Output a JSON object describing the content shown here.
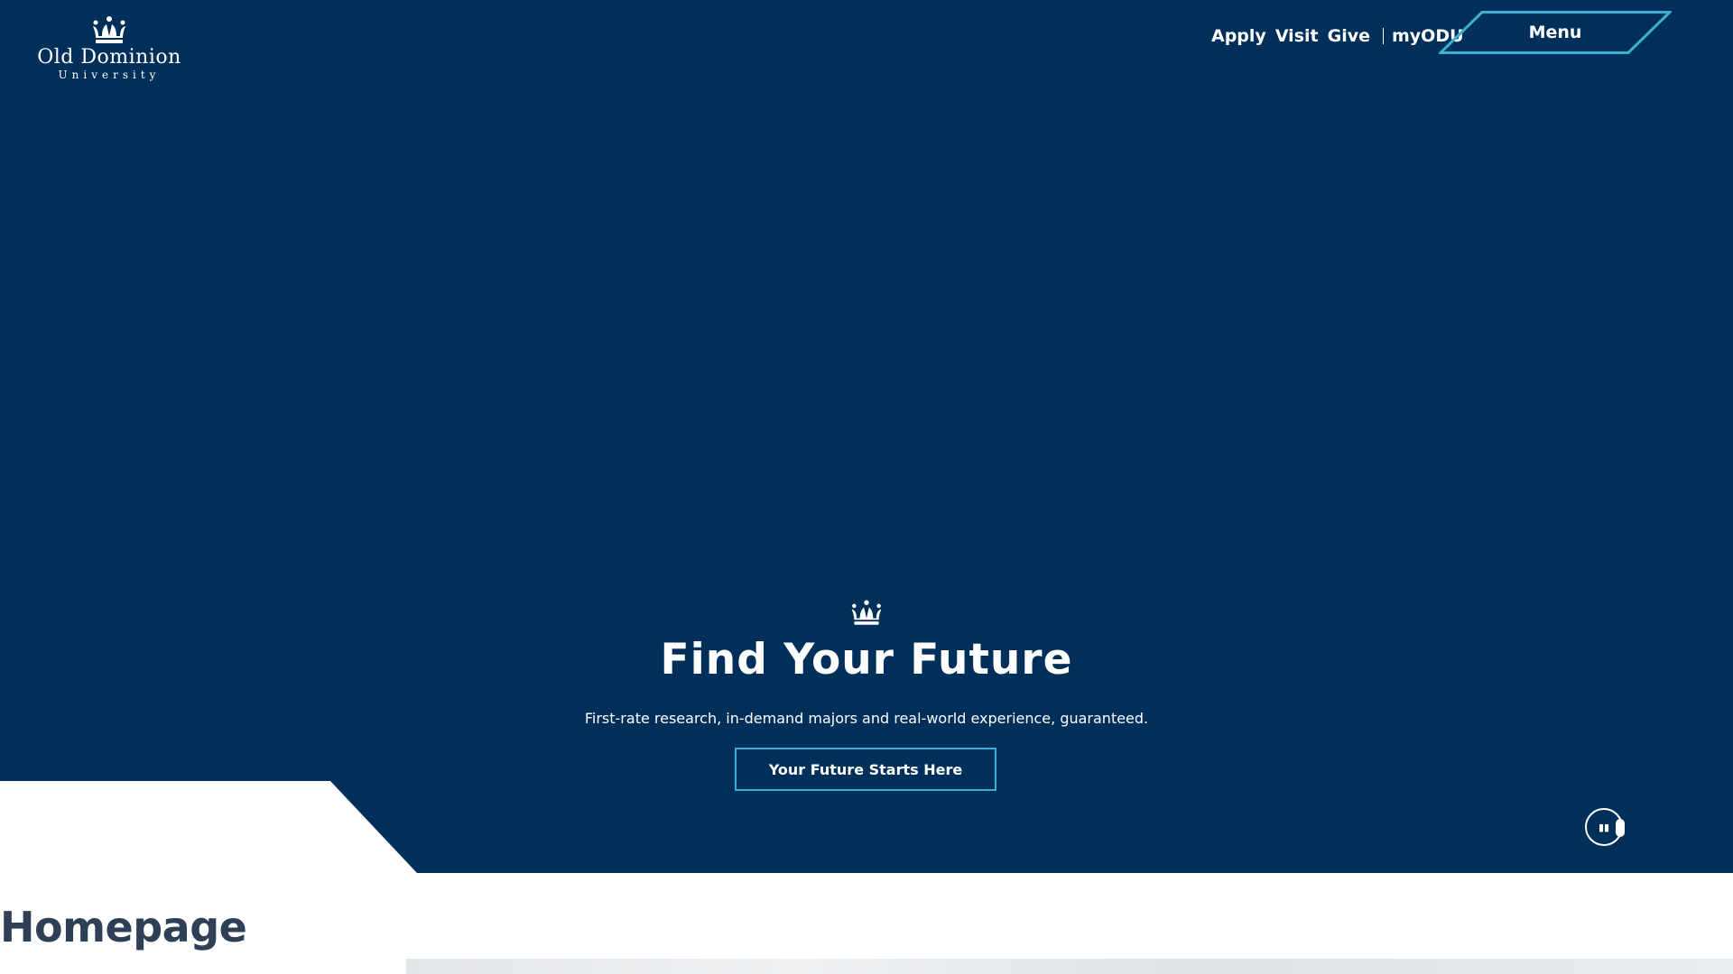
{
  "brand": {
    "name_line1": "Old Dominion",
    "name_line2": "University",
    "logo_icon": "crown-icon"
  },
  "nav": {
    "links": [
      "Apply",
      "Visit",
      "Give"
    ],
    "portal": "myODU",
    "menu_label": "Menu"
  },
  "hero": {
    "icon": "crown-icon",
    "title": "Find Your Future",
    "subtitle": "First-rate research, in-demand majors and real-world experience, guaranteed.",
    "cta_label": "Your Future Starts Here",
    "pause_icon": "pause-icon"
  },
  "page": {
    "title": "Homepage"
  },
  "colors": {
    "hero_bg": "#002f5a",
    "accent": "#3ab0d3",
    "title_text": "#2f3f55"
  }
}
